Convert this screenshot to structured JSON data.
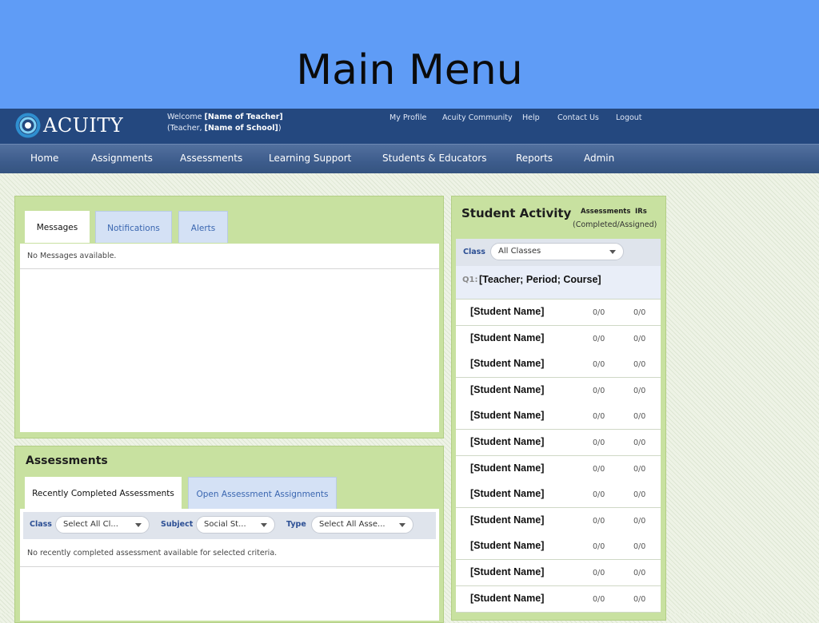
{
  "slide": {
    "title": "Main Menu"
  },
  "header": {
    "logo_text": "ACUITY",
    "welcome_prefix": "Welcome ",
    "teacher_name": "[Name of Teacher]",
    "role_prefix": "(Teacher, ",
    "school_name": "[Name of School]",
    "role_suffix": ")",
    "links": [
      "My Profile",
      "Acuity Community",
      "Help",
      "Contact Us",
      "Logout"
    ]
  },
  "nav": [
    "Home",
    "Assignments",
    "Assessments",
    "Learning Support",
    "Students & Educators",
    "Reports",
    "Admin"
  ],
  "messages_panel": {
    "tabs": [
      "Messages",
      "Notifications",
      "Alerts"
    ],
    "active_tab": "Messages",
    "empty_text": "No Messages available."
  },
  "assessments_panel": {
    "title": "Assessments",
    "tabs": [
      "Recently Completed Assessments",
      "Open Assessment Assignments"
    ],
    "filters": {
      "class_label": "Class",
      "class_value": "Select All Cl...",
      "subject_label": "Subject",
      "subject_value": "Social St...",
      "type_label": "Type",
      "type_value": "Select All Asse..."
    },
    "empty_text": "No recently completed assessment available for selected criteria."
  },
  "student_activity": {
    "title": "Student Activity",
    "col_assessments": "Assessments",
    "col_irs": "IRs",
    "col_note": "(Completed/Assigned)",
    "class_label": "Class",
    "class_value": "All Classes",
    "group_prefix": "Q1:",
    "group_name": "[Teacher; Period; Course]",
    "students": [
      {
        "name": "[Student Name]",
        "assessments": "0/0",
        "irs": "0/0"
      },
      {
        "name": "[Student Name]",
        "assessments": "0/0",
        "irs": "0/0"
      },
      {
        "name": "[Student Name]",
        "assessments": "0/0",
        "irs": "0/0"
      },
      {
        "name": "[Student Name]",
        "assessments": "0/0",
        "irs": "0/0"
      },
      {
        "name": "[Student Name]",
        "assessments": "0/0",
        "irs": "0/0"
      },
      {
        "name": "[Student Name]",
        "assessments": "0/0",
        "irs": "0/0"
      },
      {
        "name": "[Student Name]",
        "assessments": "0/0",
        "irs": "0/0"
      },
      {
        "name": "[Student Name]",
        "assessments": "0/0",
        "irs": "0/0"
      },
      {
        "name": "[Student Name]",
        "assessments": "0/0",
        "irs": "0/0"
      },
      {
        "name": "[Student Name]",
        "assessments": "0/0",
        "irs": "0/0"
      },
      {
        "name": "[Student Name]",
        "assessments": "0/0",
        "irs": "0/0"
      },
      {
        "name": "[Student Name]",
        "assessments": "0/0",
        "irs": "0/0"
      }
    ]
  },
  "colors": {
    "slide_header": "#5f9cf6",
    "topbar": "#24487f",
    "navbar": "#3d5c8c",
    "panel_green": "#c8e1a0",
    "link_blue": "#3a66b0"
  }
}
